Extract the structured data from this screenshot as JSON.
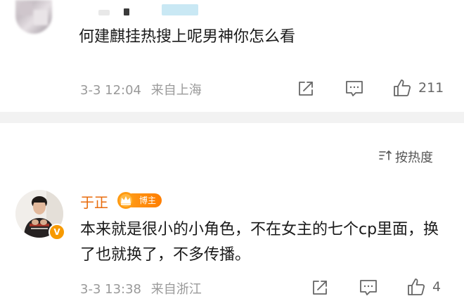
{
  "comment1": {
    "text": "何建麒挂热搜上呢男神你怎么看",
    "time": "3-3 12:04",
    "location": "来自上海",
    "like_count": "211"
  },
  "sort": {
    "label": "按热度"
  },
  "comment2": {
    "author": "于正",
    "badge": "博主",
    "verified_mark": "V",
    "text": "本来就是很小的小角色，不在女主的七个cp里面，换了也就换了，不多传播。",
    "time": "3-3 13:38",
    "location": "来自浙江",
    "like_count": "4"
  },
  "colors": {
    "author_name": "#e86b0c",
    "badge": "#ff8a00",
    "meta": "#9a9a9a",
    "divider": "#f2f2f2"
  },
  "icons": [
    "share-icon",
    "comment-icon",
    "like-icon",
    "sort-icon",
    "crown-icon"
  ]
}
